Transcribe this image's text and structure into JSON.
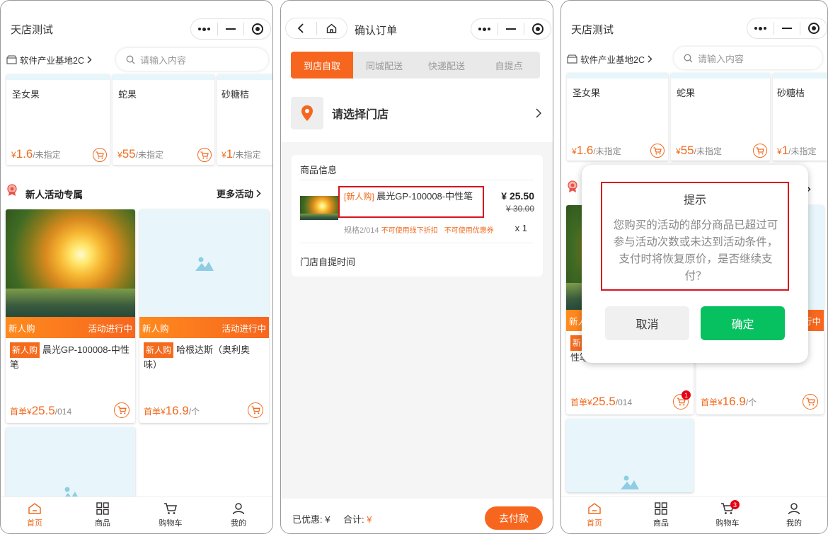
{
  "shop_title": "天店测试",
  "location": "软件产业基地2C",
  "search_placeholder": "请输入内容",
  "top_products": [
    {
      "name": "圣女果",
      "currency": "¥",
      "price": "1.6",
      "unit": "/未指定"
    },
    {
      "name": "蛇果",
      "currency": "¥",
      "price": "55",
      "unit": "/未指定"
    },
    {
      "name": "砂糖桔",
      "currency": "¥",
      "price": "1",
      "unit": "/未指定"
    }
  ],
  "section": {
    "title": "新人活动专属",
    "more": "更多活动"
  },
  "activity_goods": [
    {
      "band_left": "新人购",
      "band_right": "活动进行中",
      "tag": "新人购",
      "name": "晨光GP-100008-中性笔",
      "price_prefix": "首单¥",
      "price": "25.5",
      "unit": "/014"
    },
    {
      "band_left": "新人购",
      "band_right": "活动进行中",
      "tag": "新人购",
      "name": "哈根达斯（奥利奥味）",
      "price_prefix": "首单¥",
      "price": "16.9",
      "unit": "/个"
    }
  ],
  "tabbar": [
    {
      "label": "首页"
    },
    {
      "label": "商品"
    },
    {
      "label": "购物车"
    },
    {
      "label": "我的"
    }
  ],
  "cart_badge_p3": "3",
  "goods_badge_p3": "1",
  "order": {
    "title": "确认订单",
    "tabs": [
      "到店自取",
      "同城配送",
      "快递配送",
      "自提点"
    ],
    "store_prompt": "请选择门店",
    "goods_header": "商品信息",
    "item_tag": "[新人购]",
    "item_name": "晨光GP-100008-中性笔",
    "item_price": "¥ 25.50",
    "item_orig": "¥ 30.00",
    "item_spec": "规格2/014",
    "item_note1": "不可使用线下折扣",
    "item_note2": "不可使用优惠券",
    "item_qty": "x 1",
    "pickup_time": "门店自提时间",
    "discount_label": "已优惠: ¥",
    "total_label": "合计: ",
    "total_value": "¥",
    "pay_button": "去付款"
  },
  "dialog": {
    "title": "提示",
    "message": "您购买的活动的部分商品已超过可参与活动次数或未达到活动条件，支付时将恢复原价，是否继续支付？",
    "cancel": "取消",
    "confirm": "确定"
  },
  "colors": {
    "accent": "#f7661e",
    "confirm": "#07c160",
    "highlight": "#d9141c"
  }
}
